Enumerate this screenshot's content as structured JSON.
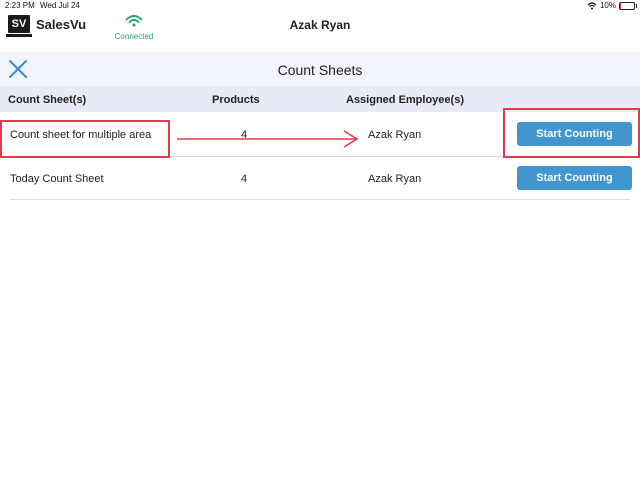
{
  "status_bar": {
    "time": "2:23 PM",
    "date": "Wed Jul 24",
    "battery_text": "10%"
  },
  "app": {
    "logo_mark": "SV",
    "logo_name": "SalesVu",
    "connection_label": "Connected",
    "user_name": "Azak Ryan"
  },
  "panel": {
    "title": "Count Sheets",
    "columns": {
      "sheet": "Count Sheet(s)",
      "products": "Products",
      "employees": "Assigned Employee(s)"
    },
    "rows": [
      {
        "name": "Count sheet for multiple area",
        "products": "4",
        "employee": "Azak Ryan",
        "button": "Start Counting"
      },
      {
        "name": "Today Count Sheet",
        "products": "4",
        "employee": "Azak Ryan",
        "button": "Start Counting"
      }
    ]
  },
  "colors": {
    "accent": "#4196d0",
    "connected": "#2aa36b",
    "annotation": "#e23b4a"
  },
  "icons": [
    "wifi-icon",
    "battery-icon",
    "connected-wifi-icon",
    "close-icon",
    "arrow-right-icon"
  ]
}
